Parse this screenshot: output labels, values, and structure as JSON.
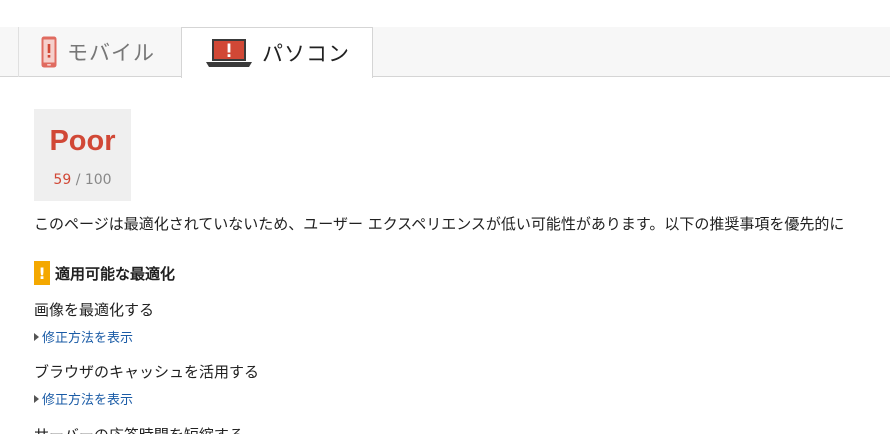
{
  "tabs": [
    {
      "label": "モバイル",
      "icon": "mobile-phone-warning-icon",
      "selected": false
    },
    {
      "label": "パソコン",
      "icon": "laptop-warning-icon",
      "selected": true
    }
  ],
  "score": {
    "rating": "Poor",
    "value": "59",
    "max": "/ 100",
    "color": "#d14836"
  },
  "summary": "このページは最適化されていないため、ユーザー エクスペリエンスが低い可能性があります。以下の推奨事項を優先的に",
  "section": {
    "icon": "warning-icon",
    "badge": "!",
    "badge_color": "#f4a800",
    "title": "適用可能な最適化"
  },
  "rules": [
    {
      "title": "画像を最適化する",
      "link": "修正方法を表示"
    },
    {
      "title": "ブラウザのキャッシュを活用する",
      "link": "修正方法を表示"
    },
    {
      "title": "サーバーの応答時間を短縮する"
    }
  ]
}
